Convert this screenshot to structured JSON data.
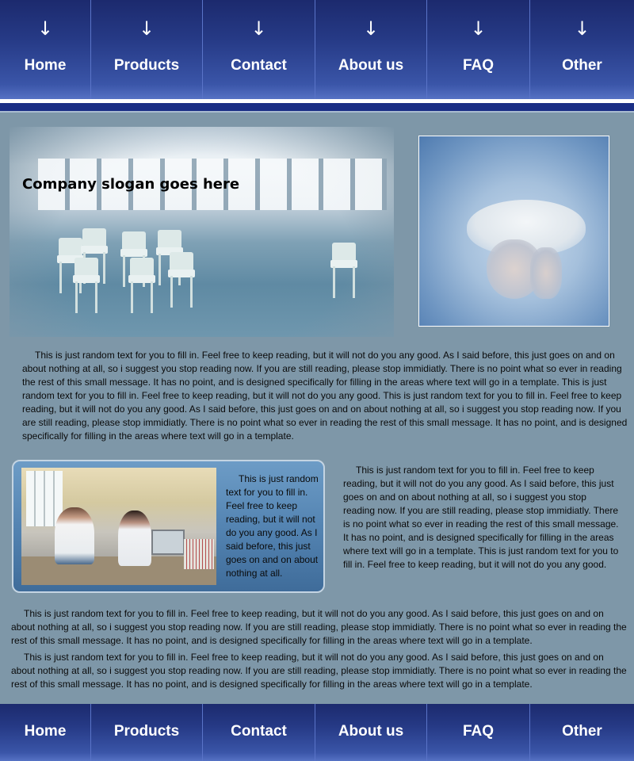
{
  "nav": {
    "items": [
      {
        "label": "Home"
      },
      {
        "label": "Products"
      },
      {
        "label": "Contact"
      },
      {
        "label": "About us"
      },
      {
        "label": "FAQ"
      },
      {
        "label": "Other"
      }
    ],
    "arrow_glyph": "↓"
  },
  "hero": {
    "slogan": "Company slogan goes here"
  },
  "body": {
    "paragraph_1": "This is just random text for you to fill in.  Feel free to keep reading, but it will not do you any good.  As I said before, this just goes on and on about nothing at all, so i suggest you stop reading now.  If you are still reading, please stop immidiatly.  There is no point what so ever in reading the rest of this small message.  It has no point, and is designed specifically for filling in the areas where text will go in a template.  This is just random text for you to fill in.  Feel free to keep reading, but it will not do you any good. This is just random text for you to fill in.  Feel free to keep reading, but it will not do you any good.  As I said before, this just goes on and on about nothing at all, so i suggest you stop reading now.  If you are still reading, please stop immidiatly.  There is no point what so ever in reading the rest of this small message.  It has no point, and is designed specifically for filling in the areas where text will go in a template.",
    "card_text": "This is just random text for you to fill in.  Feel free to keep reading, but it will not do you any good.  As I said before, this just goes on and on about nothing at all.",
    "paragraph_2": "This is just random text for you to fill in.  Feel free to keep reading, but it will not do you any good.  As I said before, this just goes on and on about nothing at all, so i suggest you stop reading now.  If you are still reading, please stop immidiatly.  There is no point what so ever in reading the rest of this small message.  It has no point, and is designed specifically for filling in the areas where text will go in a template. This is just random text for you to fill in.  Feel free to keep reading, but it will not do you any good.",
    "paragraph_3": "This is just random text for you to fill in.  Feel free to keep reading, but it will not do you any good.  As I said before, this just goes on and on about nothing at all, so i suggest you stop reading now.  If you are still reading, please stop immidiatly.  There is no point what so ever in reading the rest of this small message.  It has no point, and is designed specifically for filling in the areas where text will go in a template.",
    "paragraph_4": "This is just random text for you to fill in.  Feel free to keep reading, but it will not do you any good.  As I said before, this just goes on and on about nothing at all, so i suggest you stop reading now.  If you are still reading, please stop immidiatly.  There is no point what so ever in reading the rest of this small message.  It has no point, and is designed specifically for filling in the areas where text will go in a template."
  },
  "colors": {
    "page_background": "#7e97a8",
    "nav_dark": "#1c2a6e",
    "nav_light": "#5672c4",
    "nav_text": "#ffffff"
  }
}
